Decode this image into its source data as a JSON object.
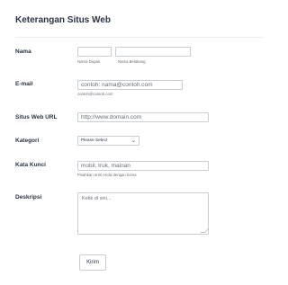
{
  "form": {
    "title": "Keterangan Situs Web",
    "name": {
      "label": "Nama",
      "first_value": "",
      "last_value": "",
      "first_sublabel": "Nama Depan",
      "last_sublabel": "Nama Belakang"
    },
    "email": {
      "label": "E-mail",
      "placeholder": "contoh: nama@contoh.com",
      "sublabel": "contoh@contoh.com"
    },
    "url": {
      "label": "Situs Web URL",
      "placeholder": "http://www.domain.com"
    },
    "category": {
      "label": "Kategori",
      "selected": "Please Select",
      "chevron": "⌄"
    },
    "keywords": {
      "label": "Kata Kunci",
      "placeholder": "mobil, truk, mainan",
      "sublabel": "Pisahkan entri Anda dengan koma"
    },
    "description": {
      "label": "Deskripsi",
      "placeholder": "Ketik di sini..."
    },
    "submit_label": "Kirim"
  },
  "colors": {
    "text": "#2c3345",
    "border": "#c8cdd6",
    "muted": "#6b6f78"
  }
}
